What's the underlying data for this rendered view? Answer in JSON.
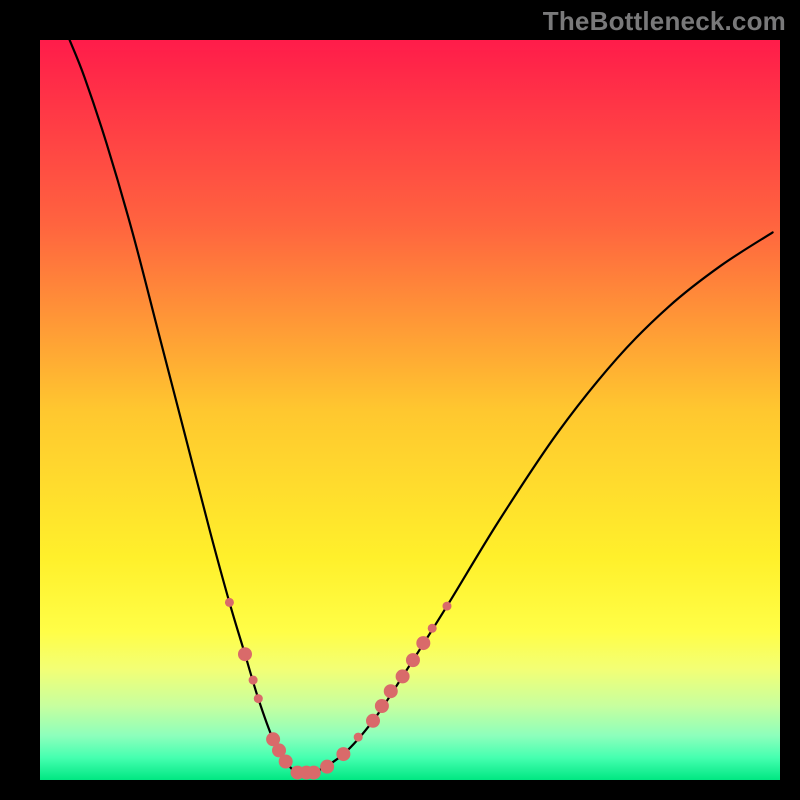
{
  "watermark": "TheBottleneck.com",
  "chart_data": {
    "type": "line",
    "title": "",
    "xlabel": "",
    "ylabel": "",
    "xlim": [
      0,
      100
    ],
    "ylim": [
      0,
      100
    ],
    "grid": false,
    "legend": false,
    "gradient_stops": [
      {
        "offset": 0.0,
        "color": "#ff1c4a"
      },
      {
        "offset": 0.25,
        "color": "#ff643f"
      },
      {
        "offset": 0.5,
        "color": "#ffc72f"
      },
      {
        "offset": 0.7,
        "color": "#fff02b"
      },
      {
        "offset": 0.8,
        "color": "#fffe47"
      },
      {
        "offset": 0.85,
        "color": "#f3ff75"
      },
      {
        "offset": 0.9,
        "color": "#c7ff9f"
      },
      {
        "offset": 0.94,
        "color": "#8dffbc"
      },
      {
        "offset": 0.97,
        "color": "#45ffb0"
      },
      {
        "offset": 1.0,
        "color": "#00e782"
      }
    ],
    "series": [
      {
        "name": "bottleneck-curve",
        "x": [
          4.0,
          6.0,
          9.0,
          12.5,
          16.0,
          19.5,
          23.0,
          25.6,
          27.7,
          29.5,
          31.5,
          33.2,
          34.8,
          37.0,
          41.0,
          45.0,
          49.0,
          55.0,
          62.0,
          70.0,
          78.0,
          85.0,
          92.0,
          99.0
        ],
        "y": [
          100.0,
          95.0,
          86.0,
          74.0,
          60.5,
          47.0,
          33.5,
          24.0,
          17.0,
          11.0,
          5.5,
          2.5,
          1.0,
          1.0,
          3.5,
          8.0,
          14.0,
          23.5,
          35.0,
          47.0,
          57.0,
          64.0,
          69.5,
          74.0
        ]
      }
    ],
    "markers": {
      "name": "highlight-dots",
      "color": "#d96a6a",
      "radius_small": 4.5,
      "radius_large": 7,
      "points": [
        {
          "x": 25.6,
          "y": 24.0,
          "r": 4.5
        },
        {
          "x": 27.7,
          "y": 17.0,
          "r": 7
        },
        {
          "x": 28.8,
          "y": 13.5,
          "r": 4.5
        },
        {
          "x": 29.5,
          "y": 11.0,
          "r": 4.5
        },
        {
          "x": 31.5,
          "y": 5.5,
          "r": 7
        },
        {
          "x": 32.3,
          "y": 4.0,
          "r": 7
        },
        {
          "x": 33.2,
          "y": 2.5,
          "r": 7
        },
        {
          "x": 34.8,
          "y": 1.0,
          "r": 7
        },
        {
          "x": 36.0,
          "y": 1.0,
          "r": 7
        },
        {
          "x": 37.0,
          "y": 1.0,
          "r": 7
        },
        {
          "x": 38.8,
          "y": 1.8,
          "r": 7
        },
        {
          "x": 41.0,
          "y": 3.5,
          "r": 7
        },
        {
          "x": 43.0,
          "y": 5.8,
          "r": 4.5
        },
        {
          "x": 45.0,
          "y": 8.0,
          "r": 7
        },
        {
          "x": 46.2,
          "y": 10.0,
          "r": 7
        },
        {
          "x": 47.4,
          "y": 12.0,
          "r": 7
        },
        {
          "x": 49.0,
          "y": 14.0,
          "r": 7
        },
        {
          "x": 50.4,
          "y": 16.2,
          "r": 7
        },
        {
          "x": 51.8,
          "y": 18.5,
          "r": 7
        },
        {
          "x": 53.0,
          "y": 20.5,
          "r": 4.5
        },
        {
          "x": 55.0,
          "y": 23.5,
          "r": 4.5
        }
      ]
    }
  }
}
